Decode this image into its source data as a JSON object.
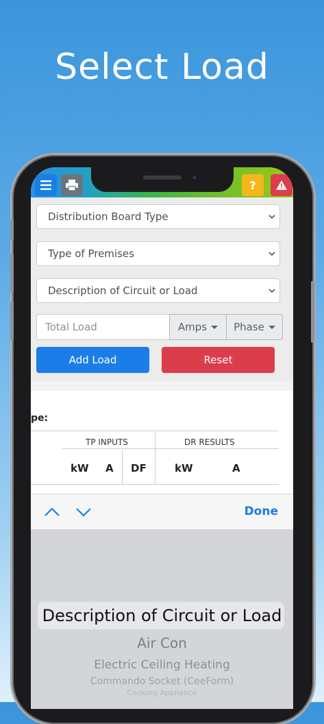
{
  "headline": "Select Load",
  "topbar": {
    "icons": [
      "menu-icon",
      "print-icon",
      "help-icon",
      "warning-icon"
    ],
    "help_label": "?"
  },
  "form": {
    "distribution_board": "Distribution Board Type",
    "premises": "Type of Premises",
    "description": "Description of Circuit or Load",
    "total_load_placeholder": "Total Load",
    "amps_label": "Amps",
    "phase_label": "Phase",
    "add_label": "Add Load",
    "reset_label": "Reset"
  },
  "table": {
    "type_label": "pe:",
    "group_tp": "TP INPUTS",
    "group_dr": "DR RESULTS",
    "cols": [
      "kW",
      "A",
      "DF",
      "kW",
      "A"
    ]
  },
  "toolbar": {
    "done_label": "Done"
  },
  "picker": {
    "selected": "Description of Circuit or Load",
    "items": [
      "Air Con",
      "Electric Ceiling Heating",
      "Commando Socket (CeeForm)",
      "Cooking Appliance"
    ]
  },
  "colors": {
    "primary": "#1a7ee6",
    "danger": "#dc3d4b",
    "warning": "#f3b71a",
    "print_gray": "#6c757d"
  }
}
